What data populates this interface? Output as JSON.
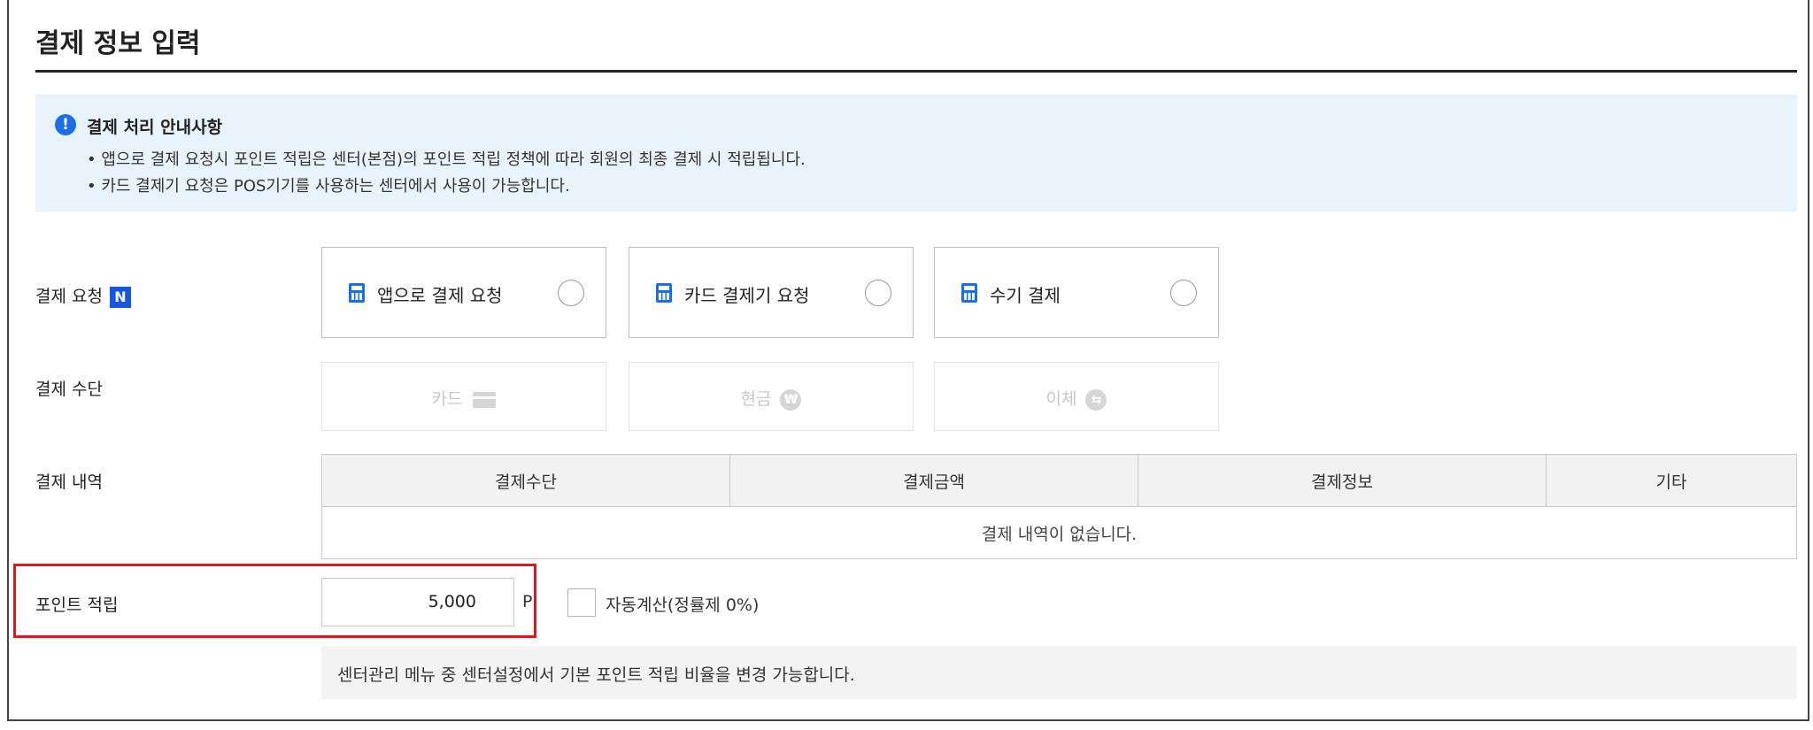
{
  "page": {
    "title": "결제 정보 입력"
  },
  "notice": {
    "icon": "info-icon",
    "icon_glyph": "!",
    "title": "결제 처리 안내사항",
    "lines": [
      "• 앱으로 결제 요청시 포인트 적립은 센터(본점)의 포인트 적립 정책에 따라 회원의 최종 결제 시 적립됩니다.",
      "• 카드 결제기 요청은 POS기기를 사용하는 센터에서 사용이 가능합니다."
    ]
  },
  "payment_request": {
    "label": "결제 요청",
    "badge": "N",
    "options": [
      {
        "label": "앱으로 결제 요청",
        "icon": "calculator-icon",
        "selected": false
      },
      {
        "label": "카드 결제기 요청",
        "icon": "calculator-icon",
        "selected": false
      },
      {
        "label": "수기 결제",
        "icon": "calculator-icon",
        "selected": false
      }
    ]
  },
  "payment_method": {
    "label": "결제 수단",
    "options": [
      {
        "label": "카드",
        "icon": "card-icon",
        "disabled": true
      },
      {
        "label": "현금",
        "icon": "won-icon",
        "icon_glyph": "₩",
        "disabled": true
      },
      {
        "label": "이체",
        "icon": "transfer-icon",
        "icon_glyph": "⇆",
        "disabled": true
      }
    ]
  },
  "history": {
    "label": "결제 내역",
    "columns": [
      "결제수단",
      "결제금액",
      "결제정보",
      "기타"
    ],
    "empty_text": "결제 내역이 없습니다."
  },
  "points": {
    "label": "포인트 적립",
    "value": "5,000",
    "unit": "P",
    "auto_calc_label": "자동계산(정률제 0%)",
    "auto_calc_checked": false,
    "highlight_color": "#e3141b"
  },
  "help": {
    "text": "센터관리 메뉴 중 센터설정에서 기본 포인트 적립 비율을 변경 가능합니다."
  },
  "colors": {
    "accent": "#1a6ee8",
    "notice_bg": "#e8f3fc"
  }
}
